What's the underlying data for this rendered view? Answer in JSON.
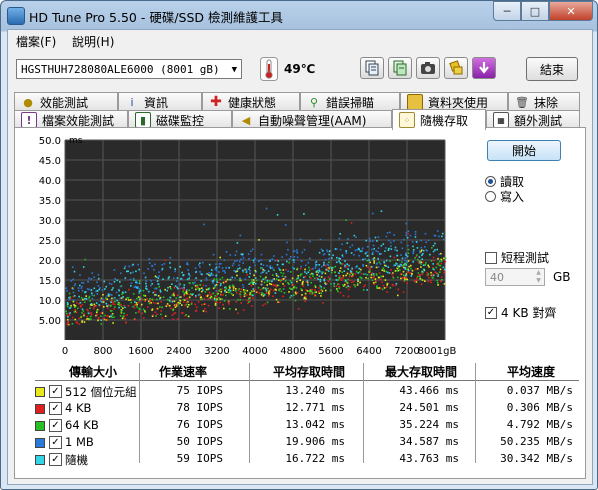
{
  "window": {
    "title": "HD Tune Pro 5.50 - 硬碟/SSD 檢測維護工具",
    "controls": [
      "─",
      "□",
      "✕"
    ]
  },
  "menu": [
    {
      "label": "檔案(F)"
    },
    {
      "label": "說明(H)"
    }
  ],
  "toolbar": {
    "drive": "HGSTHUH728080ALE6000 (8001 gB)",
    "temperature": "49℃",
    "buttons": [
      "copy-info-icon",
      "copy-text-icon",
      "screenshot-icon",
      "options-icon",
      "save-icon"
    ],
    "exit_label": "結束"
  },
  "tabs_row1": [
    {
      "label": "效能測試",
      "icon": "benchmark-icon"
    },
    {
      "label": "資訊",
      "icon": "info-icon"
    },
    {
      "label": "健康狀態",
      "icon": "health-icon"
    },
    {
      "label": "錯誤掃瞄",
      "icon": "error-scan-icon"
    },
    {
      "label": "資料夾使用",
      "icon": "folder-usage-icon"
    },
    {
      "label": "抹除",
      "icon": "erase-icon"
    }
  ],
  "tabs_row2": [
    {
      "label": "檔案效能測試",
      "icon": "file-benchmark-icon"
    },
    {
      "label": "磁碟監控",
      "icon": "disk-monitor-icon"
    },
    {
      "label": "自動噪聲管理(AAM)",
      "icon": "aam-icon"
    },
    {
      "label": "隨機存取",
      "icon": "random-access-icon",
      "active": true
    },
    {
      "label": "額外測試",
      "icon": "extra-tests-icon"
    }
  ],
  "side_panel": {
    "start_label": "開始",
    "read_label": "讀取",
    "write_label": "寫入",
    "mode": "read",
    "short_stroke_label": "短程測試",
    "short_stroke_checked": false,
    "short_stroke_value": "40",
    "short_stroke_unit": "GB",
    "align_label": "4 KB 對齊",
    "align_checked": true
  },
  "chart_data": {
    "type": "scatter",
    "ylabel": "ms",
    "xunit": "gB",
    "ylim": [
      0,
      50
    ],
    "xlim": [
      0,
      8001
    ],
    "yticks": [
      "5.00",
      "10.0",
      "15.0",
      "20.0",
      "25.0",
      "30.0",
      "35.0",
      "40.0",
      "45.0",
      "50.0"
    ],
    "xticks": [
      "0",
      "800",
      "1600",
      "2400",
      "3200",
      "4000",
      "4800",
      "5600",
      "6400",
      "7200",
      "8001gB"
    ],
    "grid": true,
    "series": [
      {
        "name": "512 個位元組",
        "color": "#e8e81c",
        "trend_start_ms": 7.0,
        "trend_end_ms": 18.5,
        "spread_ms": 6.5
      },
      {
        "name": "4 KB",
        "color": "#e02020",
        "trend_start_ms": 6.5,
        "trend_end_ms": 17.5,
        "spread_ms": 6.0
      },
      {
        "name": "64 KB",
        "color": "#24c024",
        "trend_start_ms": 8.0,
        "trend_end_ms": 18.5,
        "spread_ms": 6.5
      },
      {
        "name": "1 MB",
        "color": "#2a78d8",
        "trend_start_ms": 13.0,
        "trend_end_ms": 25.0,
        "spread_ms": 7.0
      },
      {
        "name": "隨機",
        "color": "#33d4e6",
        "trend_start_ms": 11.0,
        "trend_end_ms": 22.0,
        "spread_ms": 9.0
      }
    ]
  },
  "results": {
    "headers": [
      "傳輸大小",
      "作業速率",
      "平均存取時間",
      "最大存取時間",
      "平均速度"
    ],
    "rows": [
      {
        "size": "512 個位元組",
        "color": "#e8e81c",
        "iops": "75 IOPS",
        "avg": "13.240 ms",
        "max": "43.466 ms",
        "speed": "0.037 MB/s",
        "checked": true
      },
      {
        "size": "4 KB",
        "color": "#e02020",
        "iops": "78 IOPS",
        "avg": "12.771 ms",
        "max": "24.501 ms",
        "speed": "0.306 MB/s",
        "checked": true
      },
      {
        "size": "64 KB",
        "color": "#24c024",
        "iops": "76 IOPS",
        "avg": "13.042 ms",
        "max": "35.224 ms",
        "speed": "4.792 MB/s",
        "checked": true
      },
      {
        "size": "1 MB",
        "color": "#2a78d8",
        "iops": "50 IOPS",
        "avg": "19.906 ms",
        "max": "34.587 ms",
        "speed": "50.235 MB/s",
        "checked": true
      },
      {
        "size": "隨機",
        "color": "#33d4e6",
        "iops": "59 IOPS",
        "avg": "16.722 ms",
        "max": "43.763 ms",
        "speed": "30.342 MB/s",
        "checked": true
      }
    ]
  }
}
